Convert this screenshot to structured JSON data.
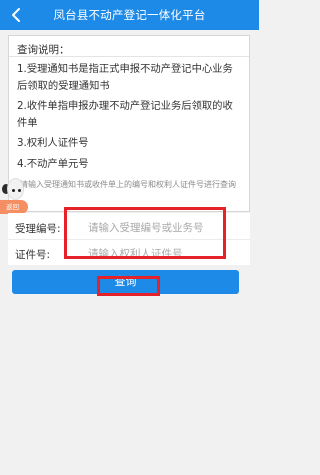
{
  "header": {
    "title": "凤台县不动产登记一体化平台",
    "back_icon": "chevron-left-icon"
  },
  "instructions": {
    "heading": "查询说明：",
    "items": [
      "1.受理通知书是指正式申报不动产登记中心业务后领取的受理通知书",
      "2.收件单指申报办理不动产登记业务后领取的收件单",
      "3.权利人证件号",
      "4.不动产单元号"
    ],
    "hint": "请输入受理通知书或收件单上的编号和权利人证件号进行查询"
  },
  "feedback": {
    "label": "返回"
  },
  "form": {
    "acceptance_label": "受理编号:",
    "acceptance_placeholder": "请输入受理编号或业务号",
    "acceptance_value": "",
    "id_label": "证件号:",
    "id_placeholder": "请输入权利人证件号",
    "id_value": ""
  },
  "query_button": {
    "label": "查询"
  },
  "colors": {
    "primary": "#1e8ae8",
    "highlight": "#e5212a",
    "feedback": "#f58e62"
  }
}
